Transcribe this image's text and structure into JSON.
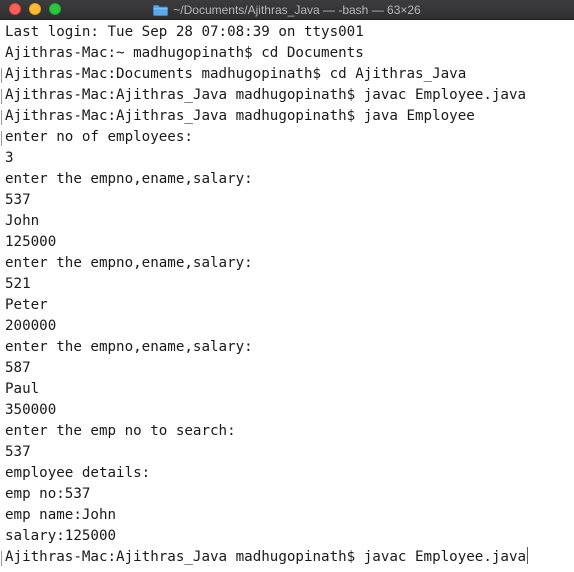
{
  "window": {
    "title": "~/Documents/Ajithras_Java — -bash — 63×26"
  },
  "terminal": {
    "lines": [
      "Last login: Tue Sep 28 07:08:39 on ttys001",
      "Ajithras-Mac:~ madhugopinath$ cd Documents",
      "Ajithras-Mac:Documents madhugopinath$ cd Ajithras_Java",
      "Ajithras-Mac:Ajithras_Java madhugopinath$ javac Employee.java",
      "Ajithras-Mac:Ajithras_Java madhugopinath$ java Employee",
      "enter no of employees:",
      "3",
      "enter the empno,ename,salary:",
      "537",
      "John",
      "125000",
      "enter the empno,ename,salary:",
      "521",
      "Peter",
      "200000",
      "enter the empno,ename,salary:",
      "587",
      "Paul",
      "350000",
      "enter the emp no to search:",
      "537",
      "employee details:",
      "emp no:537",
      "emp name:John",
      "salary:125000",
      "Ajithras-Mac:Ajithras_Java madhugopinath$ javac Employee.java"
    ]
  },
  "colors": {
    "close": "#fe5f57",
    "minimize": "#febc2e",
    "maximize": "#28c840",
    "folder": "#5aa9e6"
  }
}
